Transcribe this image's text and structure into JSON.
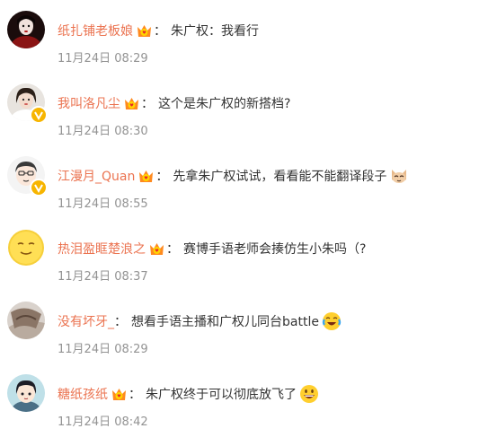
{
  "comments": [
    {
      "user": "纸扎铺老板娘",
      "sep": "：",
      "text": "朱广权：我看行",
      "time": "11月24日 08:29"
    },
    {
      "user": "我叫洛凡尘",
      "sep": "：",
      "text": "这个是朱广权的新搭档?",
      "time": "11月24日 08:30"
    },
    {
      "user": "江漫月_Quan",
      "sep": "：",
      "text": "先拿朱广权试试，看看能不能翻译段子",
      "time": "11月24日 08:55",
      "emoji": "cat-face"
    },
    {
      "user": "热泪盈眶楚浪之",
      "sep": "：",
      "text": "赛博手语老师会揍仿生小朱吗（?",
      "time": "11月24日 08:37"
    },
    {
      "user": "没有坏牙_",
      "sep": "：",
      "text": "想看手语主播和广权儿同台battle",
      "time": "11月24日 08:29",
      "emoji": "crying-laughing-face"
    },
    {
      "user": "糖纸孩纸",
      "sep": "：",
      "text": "朱广权终于可以彻底放飞了",
      "time": "11月24日 08:42",
      "emoji": "grinning-face"
    }
  ],
  "colors": {
    "username": "#eb7350",
    "text": "#333333",
    "time": "#939393",
    "verified": "#f7b500"
  }
}
